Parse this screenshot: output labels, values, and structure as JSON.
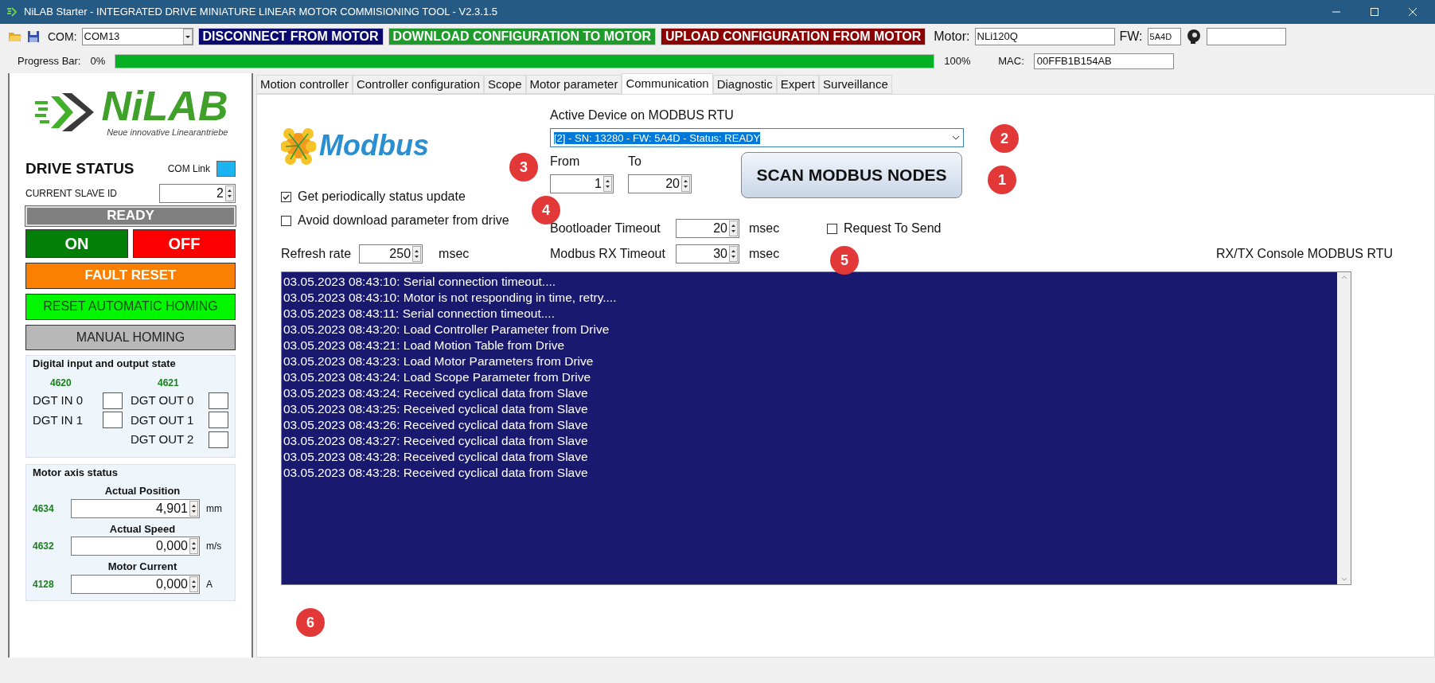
{
  "window": {
    "title": "NiLAB Starter - INTEGRATED DRIVE MINIATURE LINEAR MOTOR COMMISIONING TOOL - V2.3.1.5"
  },
  "toolbar": {
    "com_label": "COM:",
    "com_value": "COM13",
    "buttons": [
      {
        "label": "DISCONNECT FROM MOTOR",
        "color": "#0a0a6e"
      },
      {
        "label": "DOWNLOAD CONFIGURATION TO MOTOR",
        "color": "#1e9b2a"
      },
      {
        "label": "UPLOAD CONFIGURATION FROM MOTOR",
        "color": "#8b0000"
      }
    ],
    "motor_label": "Motor:",
    "motor_value": "NLi120Q",
    "fw_label": "FW:",
    "fw_value": "5A4D"
  },
  "progress": {
    "label": "Progress Bar:",
    "start": "0%",
    "level": 1.0,
    "end": "100%",
    "mac_label": "MAC:",
    "mac_value": "00FFB1B154AB"
  },
  "sidebar": {
    "logo": {
      "name": "NiLAB",
      "tagline": "Neue innovative Linearantriebe"
    },
    "drive_status": "DRIVE STATUS",
    "com_link": {
      "label": "COM Link",
      "color": "#1cb4f0"
    },
    "slave_id": {
      "label": "CURRENT SLAVE ID",
      "value": "2"
    },
    "state": "READY",
    "buttons": [
      {
        "label": "ON",
        "color": "#037f07"
      },
      {
        "label": "OFF",
        "color": "#fb0000"
      },
      {
        "label": "FAULT RESET",
        "color": "#fb7f00"
      },
      {
        "label": "RESET AUTOMATIC HOMING",
        "color": "#00f700"
      },
      {
        "label": "MANUAL HOMING",
        "color": "#b8b8b8"
      }
    ],
    "digital": {
      "title": "Digital input and output state",
      "in_code": "4620",
      "out_code": "4621",
      "inputs": [
        {
          "label": "DGT IN 0",
          "on": false
        },
        {
          "label": "DGT IN 1",
          "on": false
        }
      ],
      "outputs": [
        {
          "label": "DGT OUT 0",
          "on": false
        },
        {
          "label": "DGT OUT 1",
          "on": false
        },
        {
          "label": "DGT OUT 2",
          "on": false
        }
      ]
    },
    "axis": {
      "title": "Motor axis status",
      "rows": [
        {
          "label": "Actual Position",
          "code": "4634",
          "value": "4,901",
          "unit": "mm"
        },
        {
          "label": "Actual Speed",
          "code": "4632",
          "value": "0,000",
          "unit": "m/s"
        },
        {
          "label": "Motor Current",
          "code": "4128",
          "value": "0,000",
          "unit": "A"
        }
      ]
    }
  },
  "tabs": [
    {
      "label": "Motion controller",
      "selected": false
    },
    {
      "label": "Controller configuration",
      "selected": false
    },
    {
      "label": "Scope",
      "selected": false
    },
    {
      "label": "Motor parameter",
      "selected": false
    },
    {
      "label": "Communication",
      "selected": true
    },
    {
      "label": "Diagnostic",
      "selected": false
    },
    {
      "label": "Expert",
      "selected": false
    },
    {
      "label": "Surveillance",
      "selected": false
    }
  ],
  "communication": {
    "logo": "Modbus",
    "active_device_label": "Active Device on MODBUS RTU",
    "active_device": "[2]  - SN: 13280 - FW: 5A4D - Status: READY",
    "from_label": "From",
    "from_value": "1",
    "to_label": "To",
    "to_value": "20",
    "scan_button": "SCAN MODBUS NODES",
    "checkboxes": [
      {
        "label": "Get periodically status update",
        "checked": true
      },
      {
        "label": "Avoid download parameter from drive",
        "checked": false
      }
    ],
    "refresh": {
      "label": "Refresh rate",
      "value": "250",
      "unit": "msec"
    },
    "bootloader": {
      "label": "Bootloader Timeout",
      "value": "20",
      "unit": "msec"
    },
    "rx_timeout": {
      "label": "Modbus RX Timeout",
      "value": "30",
      "unit": "msec"
    },
    "rts": {
      "label": "Request To Send",
      "checked": false
    },
    "console_label": "RX/TX Console MODBUS RTU",
    "console": [
      "03.05.2023 08:43:10: Serial connection timeout....",
      "03.05.2023 08:43:10: Motor is not responding in time, retry....",
      "03.05.2023 08:43:11: Serial connection timeout....",
      "03.05.2023 08:43:20: Load Controller Parameter from Drive",
      "03.05.2023 08:43:21: Load Motion Table from Drive",
      "03.05.2023 08:43:23: Load Motor Parameters from Drive",
      "03.05.2023 08:43:24: Load Scope Parameter from Drive",
      "03.05.2023 08:43:24: Received cyclical data from Slave",
      "03.05.2023 08:43:25: Received cyclical data from Slave",
      "03.05.2023 08:43:26: Received cyclical data from Slave",
      "03.05.2023 08:43:27: Received cyclical data from Slave",
      "03.05.2023 08:43:28: Received cyclical data from Slave",
      "03.05.2023 08:43:28: Received cyclical data from Slave"
    ]
  },
  "callouts": [
    "1",
    "2",
    "3",
    "4",
    "5",
    "6"
  ]
}
